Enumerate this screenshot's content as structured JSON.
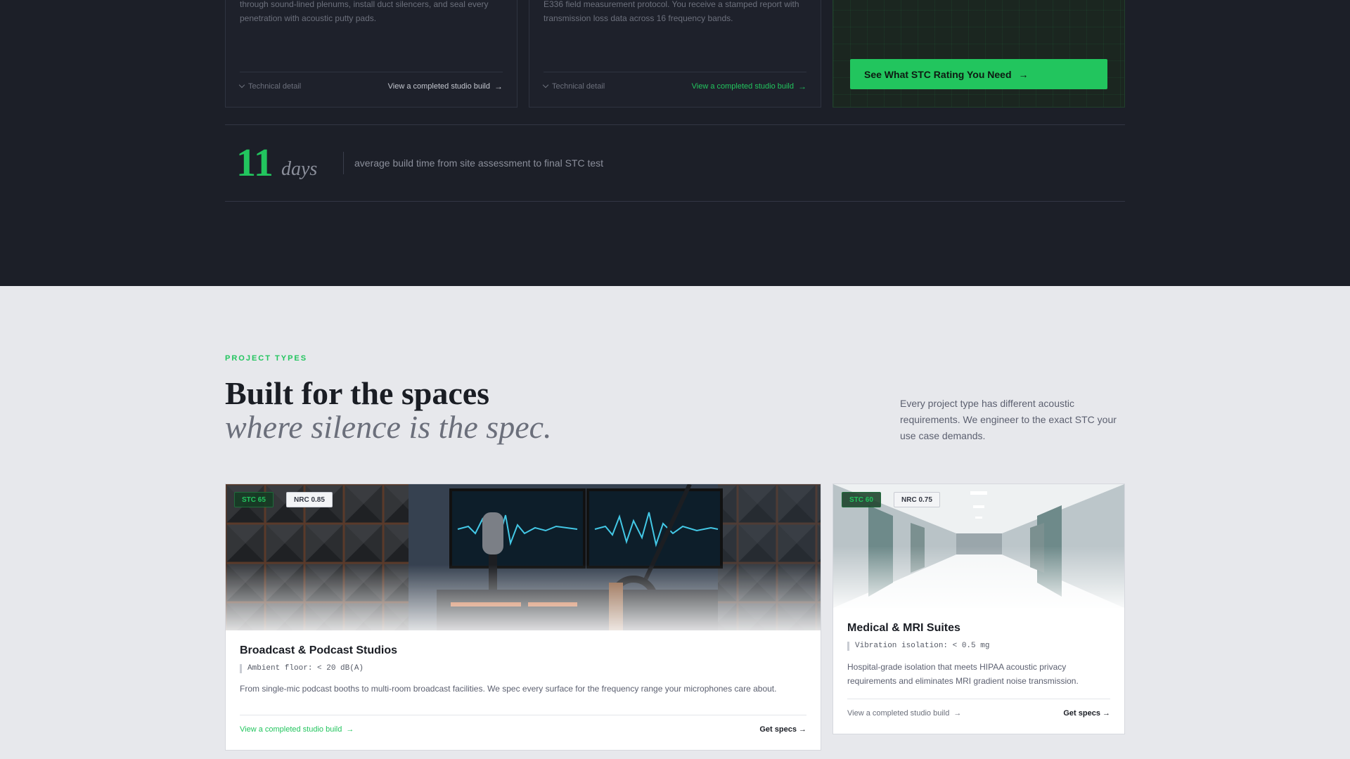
{
  "process_cards": [
    {
      "text": "through sound-lined plenums, install duct silencers, and seal every penetration with acoustic putty pads.",
      "tech": "Technical detail",
      "view": "View a completed studio build"
    },
    {
      "text": "E336 field measurement protocol. You receive a stamped report with transmission loss data across 16 frequency bands.",
      "tech": "Technical detail",
      "view": "View a completed studio build"
    }
  ],
  "cta": {
    "label": "See What STC Rating You Need"
  },
  "stat": {
    "number": "11",
    "unit": "days",
    "text": "average build time from site assessment to final STC test"
  },
  "section": {
    "eyebrow": "PROJECT TYPES",
    "heading": "Built for the spaces",
    "heading_italic": "where silence is the spec.",
    "intro": "Every project type has different acoustic requirements. We engineer to the exact STC your use case demands."
  },
  "projects": [
    {
      "stc": "STC 65",
      "nrc": "NRC 0.85",
      "title": "Broadcast & Podcast Studios",
      "spec": "Ambient floor: < 20 dB(A)",
      "desc": "From single-mic podcast booths to multi-room broadcast facilities. We spec every surface for the frequency range your microphones care about.",
      "view": "View a completed studio build",
      "get": "Get specs →"
    },
    {
      "stc": "STC 60",
      "nrc": "NRC 0.75",
      "title": "Medical & MRI Suites",
      "spec": "Vibration isolation: < 0.5 mg",
      "desc": "Hospital-grade isolation that meets HIPAA acoustic privacy requirements and eliminates MRI gradient noise transmission.",
      "view": "View a completed studio build",
      "get": "Get specs →"
    }
  ],
  "colors": {
    "accent": "#22c55e",
    "dark_bg": "#1c1f28",
    "light_bg": "#e7e8ec"
  }
}
